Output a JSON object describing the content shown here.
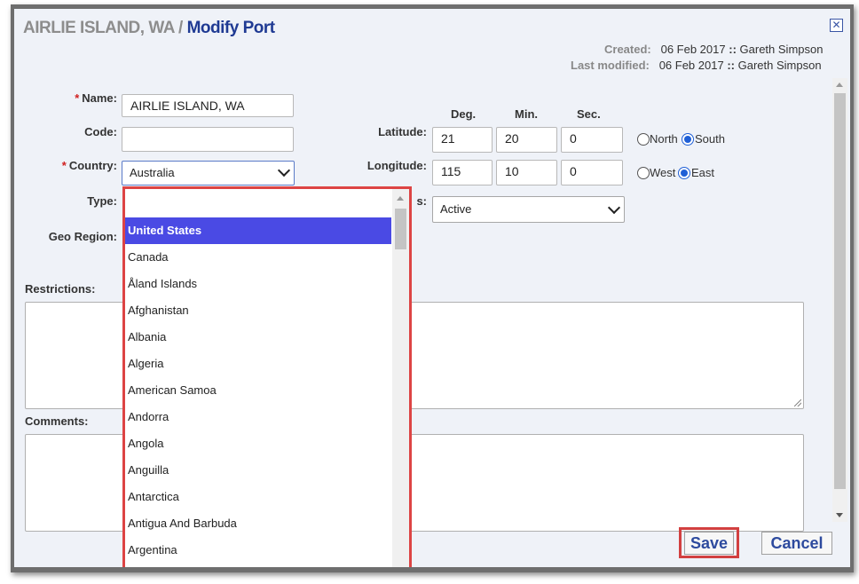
{
  "header": {
    "port_name": "AIRLIE ISLAND, WA",
    "separator": " / ",
    "action": "Modify Port",
    "close_glyph": "✕"
  },
  "meta": {
    "created_label": "Created:",
    "created_date": "06 Feb 2017",
    "created_by": "Gareth Simpson",
    "modified_label": "Last modified:",
    "modified_date": "06 Feb 2017",
    "modified_by": "Gareth Simpson",
    "sep": "::"
  },
  "form": {
    "required_mark": "*",
    "name_label": "Name:",
    "name_value": "AIRLIE ISLAND, WA",
    "code_label": "Code:",
    "code_value": "",
    "country_label": "Country:",
    "country_value": "Australia",
    "type_label": "Type:",
    "geo_region_label": "Geo Region:",
    "restrictions_label": "Restrictions:",
    "comments_label": "Comments:",
    "status_label_partial": "s:",
    "status_value": "Active"
  },
  "coords": {
    "deg_header": "Deg.",
    "min_header": "Min.",
    "sec_header": "Sec.",
    "latitude_label": "Latitude:",
    "lat_deg": "21",
    "lat_min": "20",
    "lat_sec": "0",
    "lat_north": "North",
    "lat_south": "South",
    "lat_selected": "South",
    "longitude_label": "Longitude:",
    "lon_deg": "115",
    "lon_min": "10",
    "lon_sec": "0",
    "lon_west": "West",
    "lon_east": "East",
    "lon_selected": "East"
  },
  "dropdown": {
    "options": [
      "United States",
      "Canada",
      "Åland Islands",
      "Afghanistan",
      "Albania",
      "Algeria",
      "American Samoa",
      "Andorra",
      "Angola",
      "Anguilla",
      "Antarctica",
      "Antigua And Barbuda",
      "Argentina"
    ],
    "highlighted": "United States"
  },
  "buttons": {
    "save": "Save",
    "cancel": "Cancel"
  },
  "colors": {
    "title_port": "#8d8d8d",
    "title_action": "#1f3a93",
    "highlight_border": "#dd4444",
    "selected_option_bg": "#4a4ae4",
    "radio_checked": "#1f5fd6"
  }
}
